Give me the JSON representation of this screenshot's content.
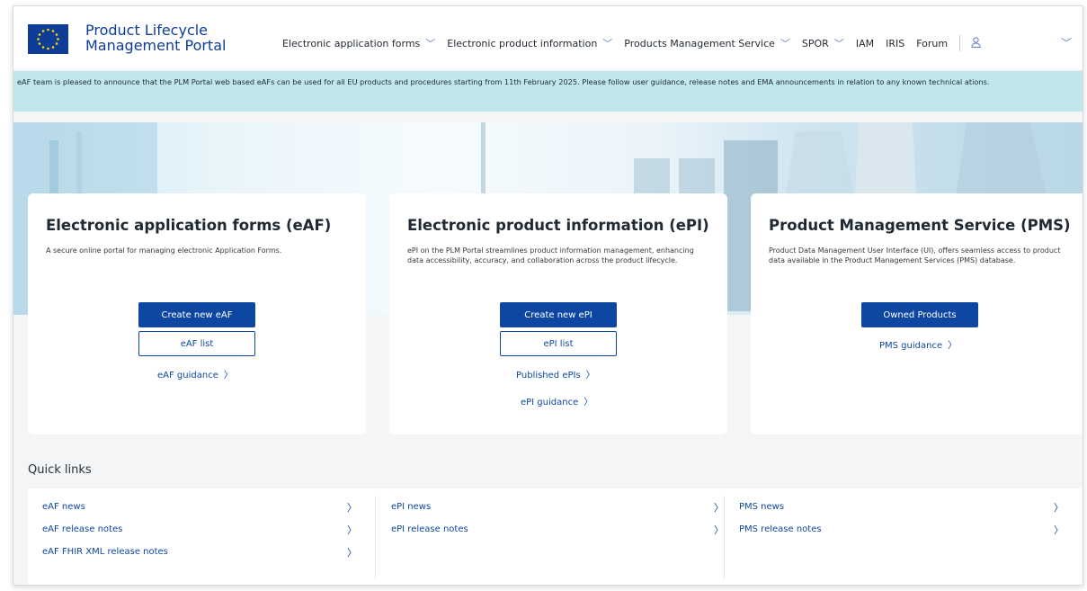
{
  "header": {
    "brand_line1": "Product Lifecycle",
    "brand_line2": "Management Portal",
    "nav": [
      {
        "label": "Electronic application forms",
        "has_dropdown": true
      },
      {
        "label": "Electronic product information",
        "has_dropdown": true
      },
      {
        "label": "Products Management Service",
        "has_dropdown": true
      },
      {
        "label": "SPOR",
        "has_dropdown": true
      },
      {
        "label": "IAM",
        "has_dropdown": false
      },
      {
        "label": "IRIS",
        "has_dropdown": false
      },
      {
        "label": "Forum",
        "has_dropdown": false
      }
    ],
    "user_icon": "user-icon",
    "menu_icon": "chevron-down-icon"
  },
  "banner": {
    "text": "eAF team is pleased to announce that the PLM Portal web based eAFs can be used for all EU products and procedures starting from 11th February 2025. Please follow user guidance, release notes and EMA announcements in relation to any known technical ations."
  },
  "cards": [
    {
      "title": "Electronic application forms (eAF)",
      "description": "A secure online portal for managing electronic Application Forms.",
      "primary_button": "Create new eAF",
      "secondary_button": "eAF list",
      "links": [
        "eAF guidance"
      ]
    },
    {
      "title": "Electronic product information (ePI)",
      "description": "ePI on the PLM Portal streamlines product information management, enhancing data accessibility, accuracy, and collaboration across the product lifecycle.",
      "primary_button": "Create new ePI",
      "secondary_button": "ePI list",
      "links": [
        "Published ePIs",
        "ePI guidance"
      ]
    },
    {
      "title": "Product Management Service (PMS)",
      "description": "Product Data Management User Interface (UI), offers seamless access to product data available in the Product Management Services (PMS) database.",
      "primary_button": "Owned Products",
      "links": [
        "PMS guidance"
      ]
    }
  ],
  "quick_links": {
    "title": "Quick links",
    "columns": [
      [
        "eAF news",
        "eAF release notes",
        "eAF FHIR XML release notes"
      ],
      [
        "ePI news",
        "ePI release notes"
      ],
      [
        "PMS news",
        "PMS release notes"
      ]
    ]
  },
  "colors": {
    "brand": "#0e3c96",
    "primary": "#0e47a1",
    "banner": "#bfe7ec"
  }
}
